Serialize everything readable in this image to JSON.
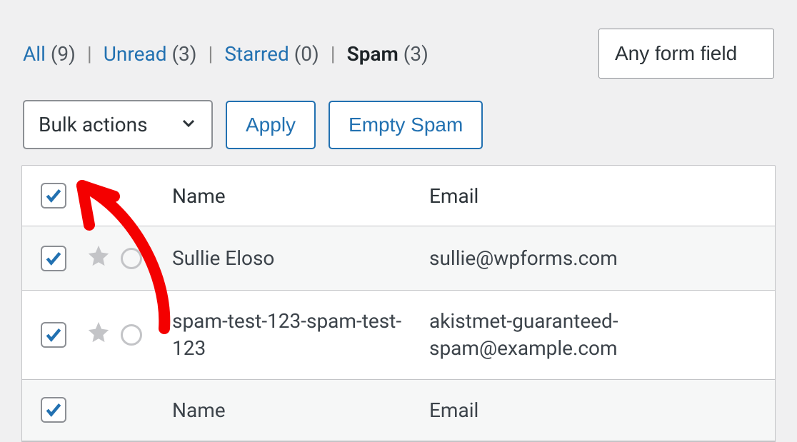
{
  "filters": {
    "all": {
      "label": "All",
      "count": "(9)"
    },
    "unread": {
      "label": "Unread",
      "count": "(3)"
    },
    "starred": {
      "label": "Starred",
      "count": "(0)"
    },
    "spam": {
      "label": "Spam",
      "count": "(3)"
    }
  },
  "search": {
    "value": "Any form field"
  },
  "bulk": {
    "label": "Bulk actions",
    "apply": "Apply",
    "empty_spam": "Empty Spam"
  },
  "columns": {
    "name": "Name",
    "email": "Email"
  },
  "rows": [
    {
      "name": "Sullie Eloso",
      "email": "sullie@wpforms.com"
    },
    {
      "name": "spam-test-123-spam-test-123",
      "email": "akistmet-guaranteed-spam@example.com"
    },
    {
      "name": "Name",
      "email": "Email"
    }
  ]
}
